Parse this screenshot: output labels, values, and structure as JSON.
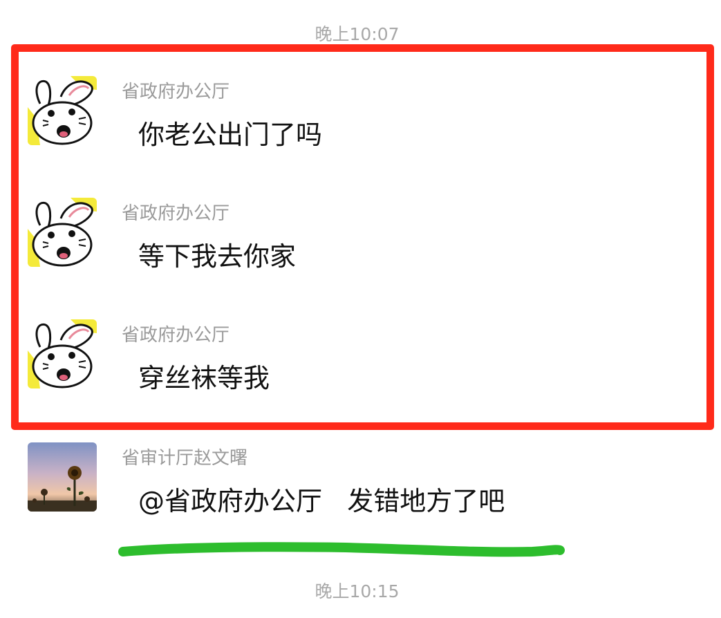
{
  "timestamps": {
    "top": "晚上10:07",
    "bottom": "晚上10:15"
  },
  "messages": [
    {
      "sender": "省政府办公厅",
      "text": "你老公出门了吗",
      "avatar": "bunny-avatar"
    },
    {
      "sender": "省政府办公厅",
      "text": "等下我去你家",
      "avatar": "bunny-avatar"
    },
    {
      "sender": "省政府办公厅",
      "text": "穿丝袜等我",
      "avatar": "bunny-avatar"
    },
    {
      "sender": "省审计厅赵文曙",
      "text": "@省政府办公厅   发错地方了吧",
      "avatar": "sunflower-sunset-avatar"
    }
  ],
  "colors": {
    "highlight_border": "#ff2a1a",
    "underline_stroke": "#2dbd2d",
    "timestamp_text": "#a8a8a8",
    "sender_text": "#9a9a9a",
    "message_text": "#111111"
  }
}
